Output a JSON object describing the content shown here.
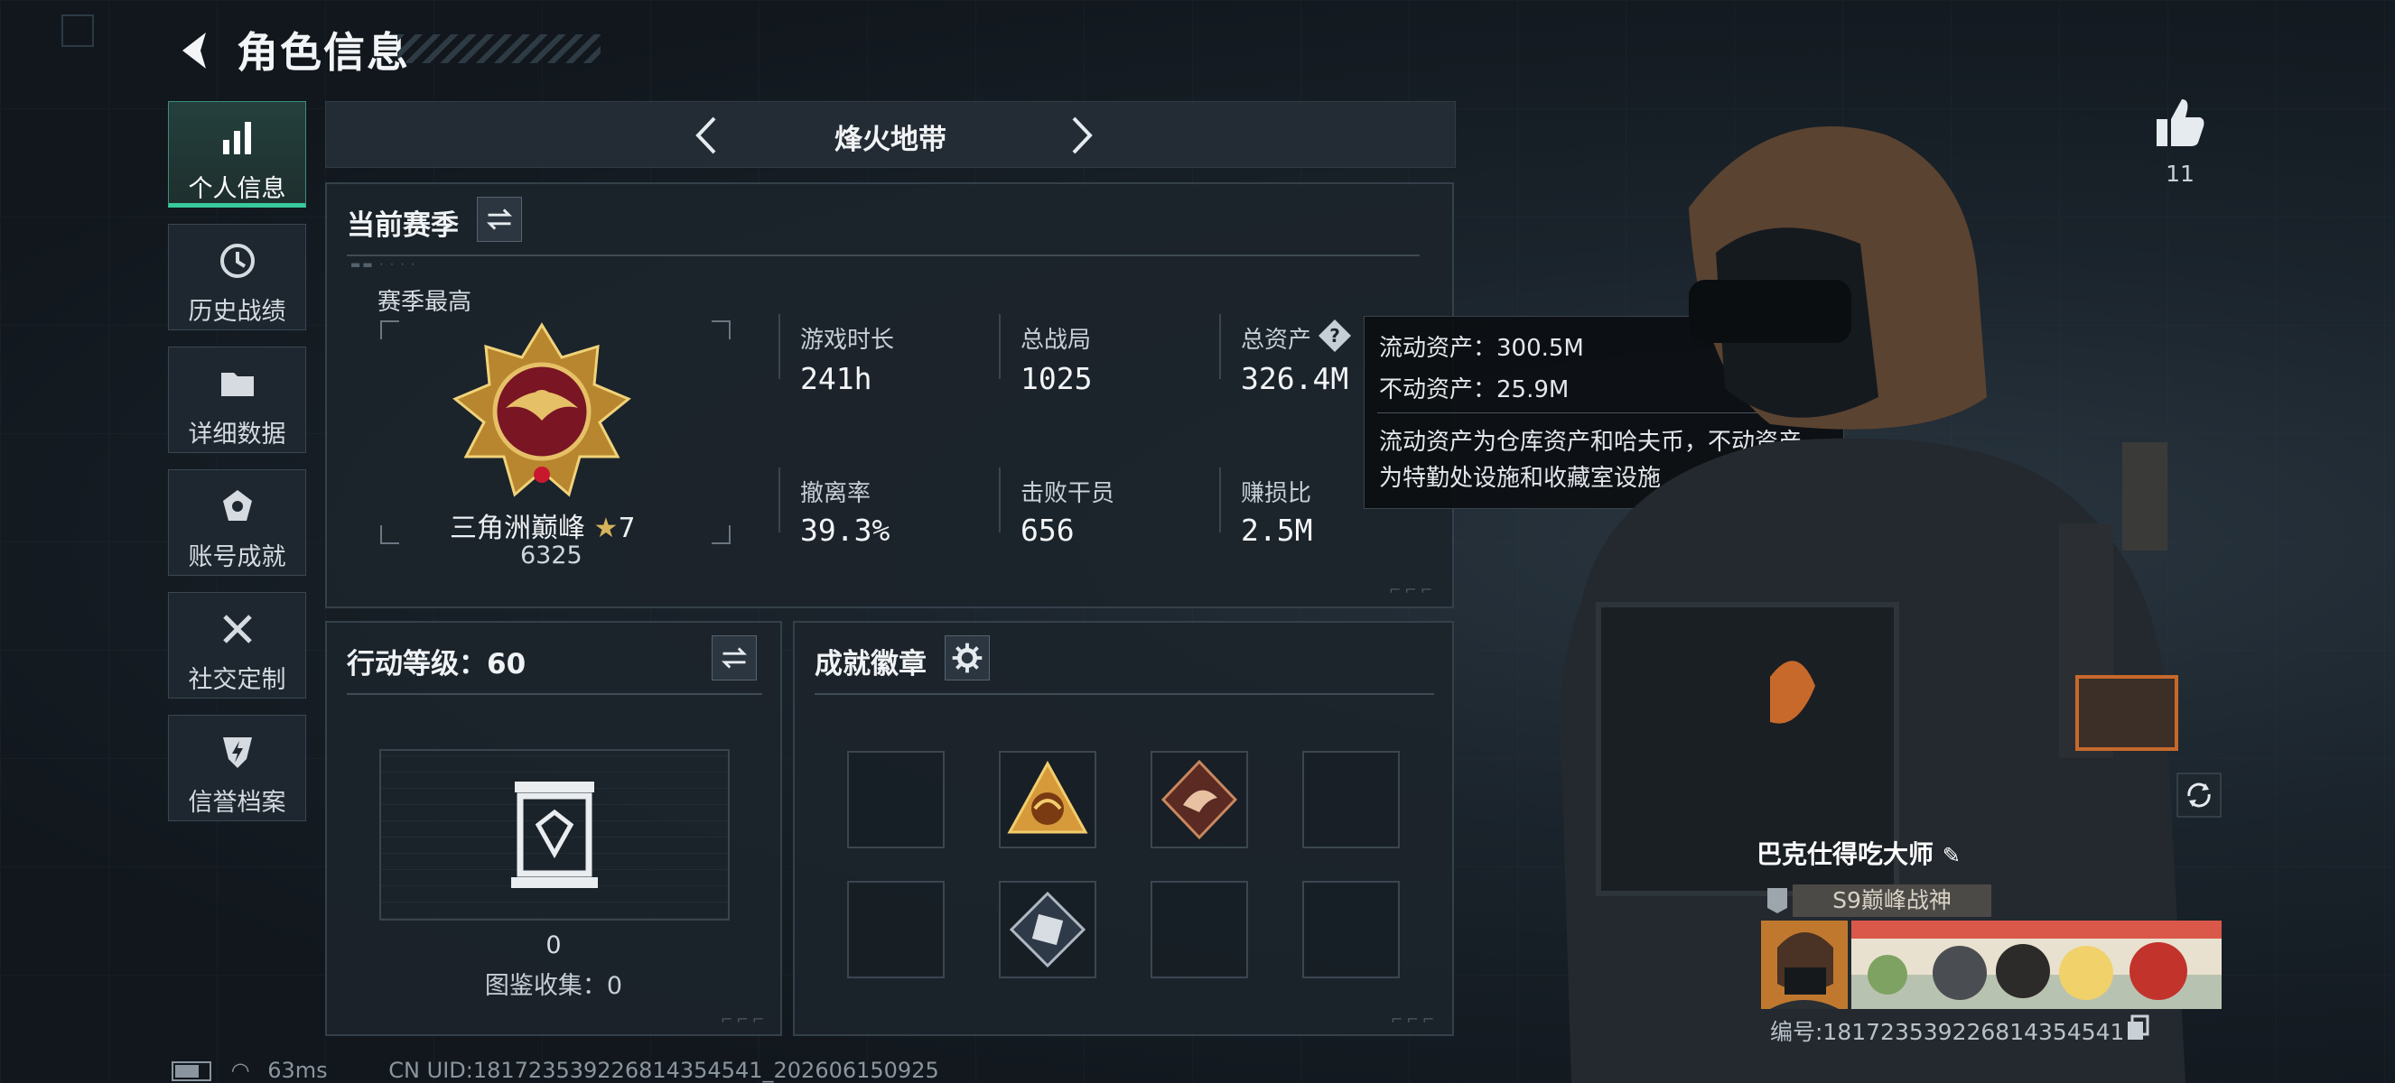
{
  "header": {
    "title": "角色信息"
  },
  "sidebar": {
    "items": [
      {
        "label": "个人信息",
        "icon": "bar-chart-icon",
        "active": true
      },
      {
        "label": "历史战绩",
        "icon": "clock-icon"
      },
      {
        "label": "详细数据",
        "icon": "folder-icon"
      },
      {
        "label": "账号成就",
        "icon": "achievement-icon"
      },
      {
        "label": "社交定制",
        "icon": "tools-icon"
      },
      {
        "label": "信誉档案",
        "icon": "shield-bolt-icon"
      }
    ]
  },
  "mode": {
    "label": "烽火地带"
  },
  "season": {
    "header": "当前赛季",
    "best_label": "赛季最高",
    "rank_name": "三角洲巅峰",
    "rank_stars": "7",
    "rank_score": "6325",
    "stats": [
      {
        "label": "游戏时长",
        "value": "241h"
      },
      {
        "label": "总战局",
        "value": "1025"
      },
      {
        "label": "总资产",
        "value": "326.4M"
      },
      {
        "label": "撤离率",
        "value": "39.3%"
      },
      {
        "label": "击败干员",
        "value": "656"
      },
      {
        "label": "赚损比",
        "value": "2.5M"
      }
    ]
  },
  "tooltip": {
    "liquid": "流动资产：300.5M",
    "fixed": "不动资产：25.9M",
    "desc_line1": "流动资产为仓库资产和哈夫币，不动资产",
    "desc_line2": "为特勤处设施和收藏室设施"
  },
  "action_level": {
    "header": "行动等级：60",
    "count": "0",
    "collection": "图鉴收集：0"
  },
  "badges": {
    "header": "成就徽章"
  },
  "player": {
    "likes": "11",
    "name": "巴克仕得吃大师",
    "title_tag": "S9巅峰战神",
    "id_text": "编号:18172353922681435454​1"
  },
  "status": {
    "ping": "63ms",
    "uid": "CN UID:18172353922681435454​1_202606150925"
  },
  "colors": {
    "accent": "#39c99c",
    "panel": "#1c242b",
    "gold": "#c9a24a"
  }
}
